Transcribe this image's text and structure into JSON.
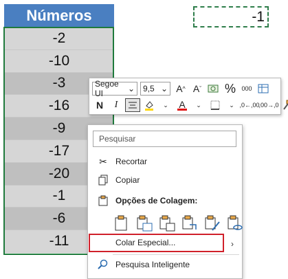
{
  "sheet": {
    "header": "Números",
    "values": [
      "-2",
      "-10",
      "-3",
      "-16",
      "-9",
      "-17",
      "-20",
      "-1",
      "-6",
      "-11"
    ],
    "copied_value": "-1"
  },
  "minibar": {
    "font": "Segoe UI",
    "size": "9,5",
    "icons": [
      "grow-font-icon",
      "shrink-font-icon",
      "currency-icon",
      "percent-icon",
      "thousands-icon",
      "format-table-icon",
      "bold-icon",
      "italic-icon",
      "center-align-icon",
      "fill-color-icon",
      "font-color-icon",
      "borders-icon",
      "increase-decimal-icon",
      "decrease-decimal-icon",
      "format-painter-icon"
    ],
    "percent": "%",
    "thousands": "000",
    "bold": "N",
    "italic": "I",
    "font_color_letter": "A",
    "inc_decimal": ",0←,00",
    "dec_decimal": ",00→,0"
  },
  "context_menu": {
    "search_placeholder": "Pesquisar",
    "items": {
      "cut": "Recortar",
      "copy": "Copiar",
      "paste_options": "Opções de Colagem:",
      "paste_special": "Colar Especial...",
      "smart_lookup": "Pesquisa Inteligente"
    }
  },
  "colors": {
    "header_bg": "#4a7fc1",
    "selection_border": "#1e7a3c",
    "highlight_box": "#d0202a"
  }
}
